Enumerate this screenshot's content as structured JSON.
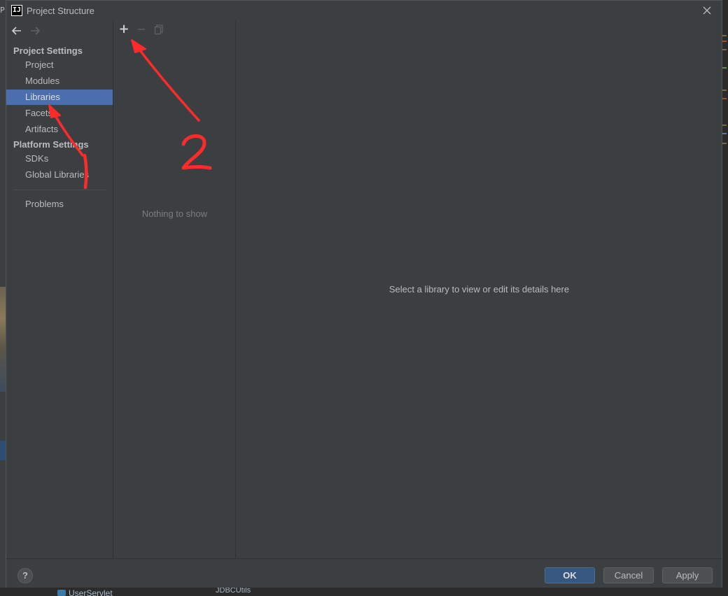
{
  "background": {
    "left_text": "P",
    "bottom_item": "UserServlet",
    "bottom_item2": "JDBCUtils"
  },
  "dialog": {
    "title": "Project Structure",
    "app_icon_label": "IJ",
    "close_icon": "close-icon"
  },
  "sidebar": {
    "project_settings_header": "Project Settings",
    "project_items": [
      {
        "label": "Project"
      },
      {
        "label": "Modules"
      },
      {
        "label": "Libraries",
        "selected": true
      },
      {
        "label": "Facets"
      },
      {
        "label": "Artifacts"
      }
    ],
    "platform_settings_header": "Platform Settings",
    "platform_items": [
      {
        "label": "SDKs"
      },
      {
        "label": "Global Libraries"
      }
    ],
    "problems_label": "Problems"
  },
  "list_panel": {
    "add_label": "+",
    "remove_label": "−",
    "empty_text": "Nothing to show"
  },
  "details": {
    "placeholder": "Select a library to view or edit its details here"
  },
  "footer": {
    "help_label": "?",
    "ok_label": "OK",
    "cancel_label": "Cancel",
    "apply_label": "Apply"
  },
  "annotations": {
    "color": "#ff2a2a",
    "label_1": "1",
    "label_2": "2"
  },
  "colors": {
    "dialog_bg": "#3c3f41",
    "selection": "#4b6eaf",
    "ok_button": "#365880"
  }
}
